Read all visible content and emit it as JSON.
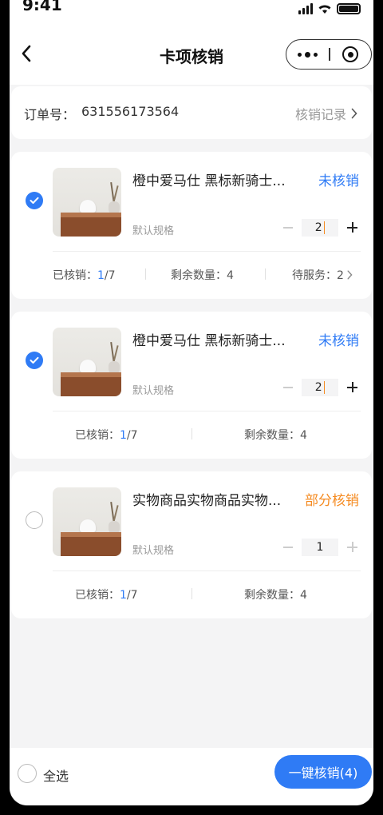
{
  "statusbar": {
    "time": "9:41"
  },
  "navbar": {
    "title": "卡项核销"
  },
  "order": {
    "label": "订单号：",
    "number": "631556173564",
    "records_label": "核销记录"
  },
  "items": [
    {
      "name": "橙中爱马仕 黑标新骑士...",
      "status": "未核销",
      "status_color": "#2f7bf5",
      "spec": "默认规格",
      "qty": "2",
      "checked": true,
      "redeemed_label": "已核销：",
      "redeemed_done": "1",
      "redeemed_total": "/7",
      "remaining_label": "剩余数量：",
      "remaining": "4",
      "pending_label": "待服务：",
      "pending": "2"
    },
    {
      "name": "橙中爱马仕 黑标新骑士...",
      "status": "未核销",
      "status_color": "#2f7bf5",
      "spec": "默认规格",
      "qty": "2",
      "checked": true,
      "redeemed_label": "已核销：",
      "redeemed_done": "1",
      "redeemed_total": "/7",
      "remaining_label": "剩余数量：",
      "remaining": "4"
    },
    {
      "name": "实物商品实物商品实物...",
      "status": "部分核销",
      "status_color": "#f58b22",
      "spec": "默认规格",
      "qty": "1",
      "checked": false,
      "redeemed_label": "已核销：",
      "redeemed_done": "1",
      "redeemed_total": "/7",
      "remaining_label": "剩余数量：",
      "remaining": "4"
    }
  ],
  "footer": {
    "select_all_label": "全选",
    "redeem_button": "一键核销(4)"
  },
  "colors": {
    "primary": "#2f7bf5",
    "orange": "#f58b22",
    "background": "#f4f4f5"
  }
}
